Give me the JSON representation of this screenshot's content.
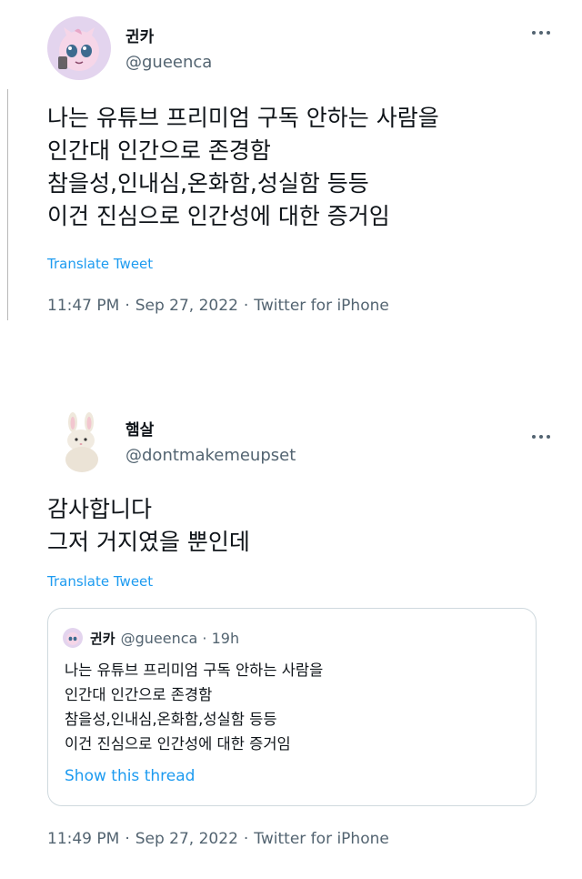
{
  "tweet1": {
    "display_name": "귄카",
    "handle": "@gueenca",
    "body_lines": [
      "나는 유튜브 프리미엄 구독 안하는 사람을",
      "인간대 인간으로 존경함",
      "참을성,인내심,온화함,성실함 등등",
      "이건 진심으로 인간성에 대한 증거임"
    ],
    "translate_label": "Translate Tweet",
    "time": "11:47 PM",
    "date": "Sep 27, 2022",
    "source": "Twitter for iPhone",
    "separator": "·",
    "avatar_icon": "jigglypuff-avatar-icon"
  },
  "tweet2": {
    "display_name": "햄살",
    "handle": "@dontmakemeupset",
    "body_lines": [
      "감사합니다",
      "그저 거지였을 뿐인데"
    ],
    "translate_label": "Translate Tweet",
    "time": "11:49 PM",
    "date": "Sep 27, 2022",
    "source": "Twitter for iPhone",
    "separator": "·",
    "avatar_icon": "bunny-plush-avatar-icon",
    "quote": {
      "display_name": "귄카",
      "handle_time": "@gueenca · 19h",
      "body_lines": [
        "나는 유튜브 프리미엄 구독 안하는 사람을",
        "인간대 인간으로 존경함",
        "참을성,인내심,온화함,성실함 등등",
        "이건 진심으로 인간성에 대한 증거임"
      ],
      "show_thread_label": "Show this thread"
    }
  },
  "colors": {
    "text_primary": "#0f1419",
    "text_secondary": "#536471",
    "link_blue": "#1d9bf0",
    "border": "#cfd9de",
    "avatar1_bg": "#e3d4ee"
  }
}
